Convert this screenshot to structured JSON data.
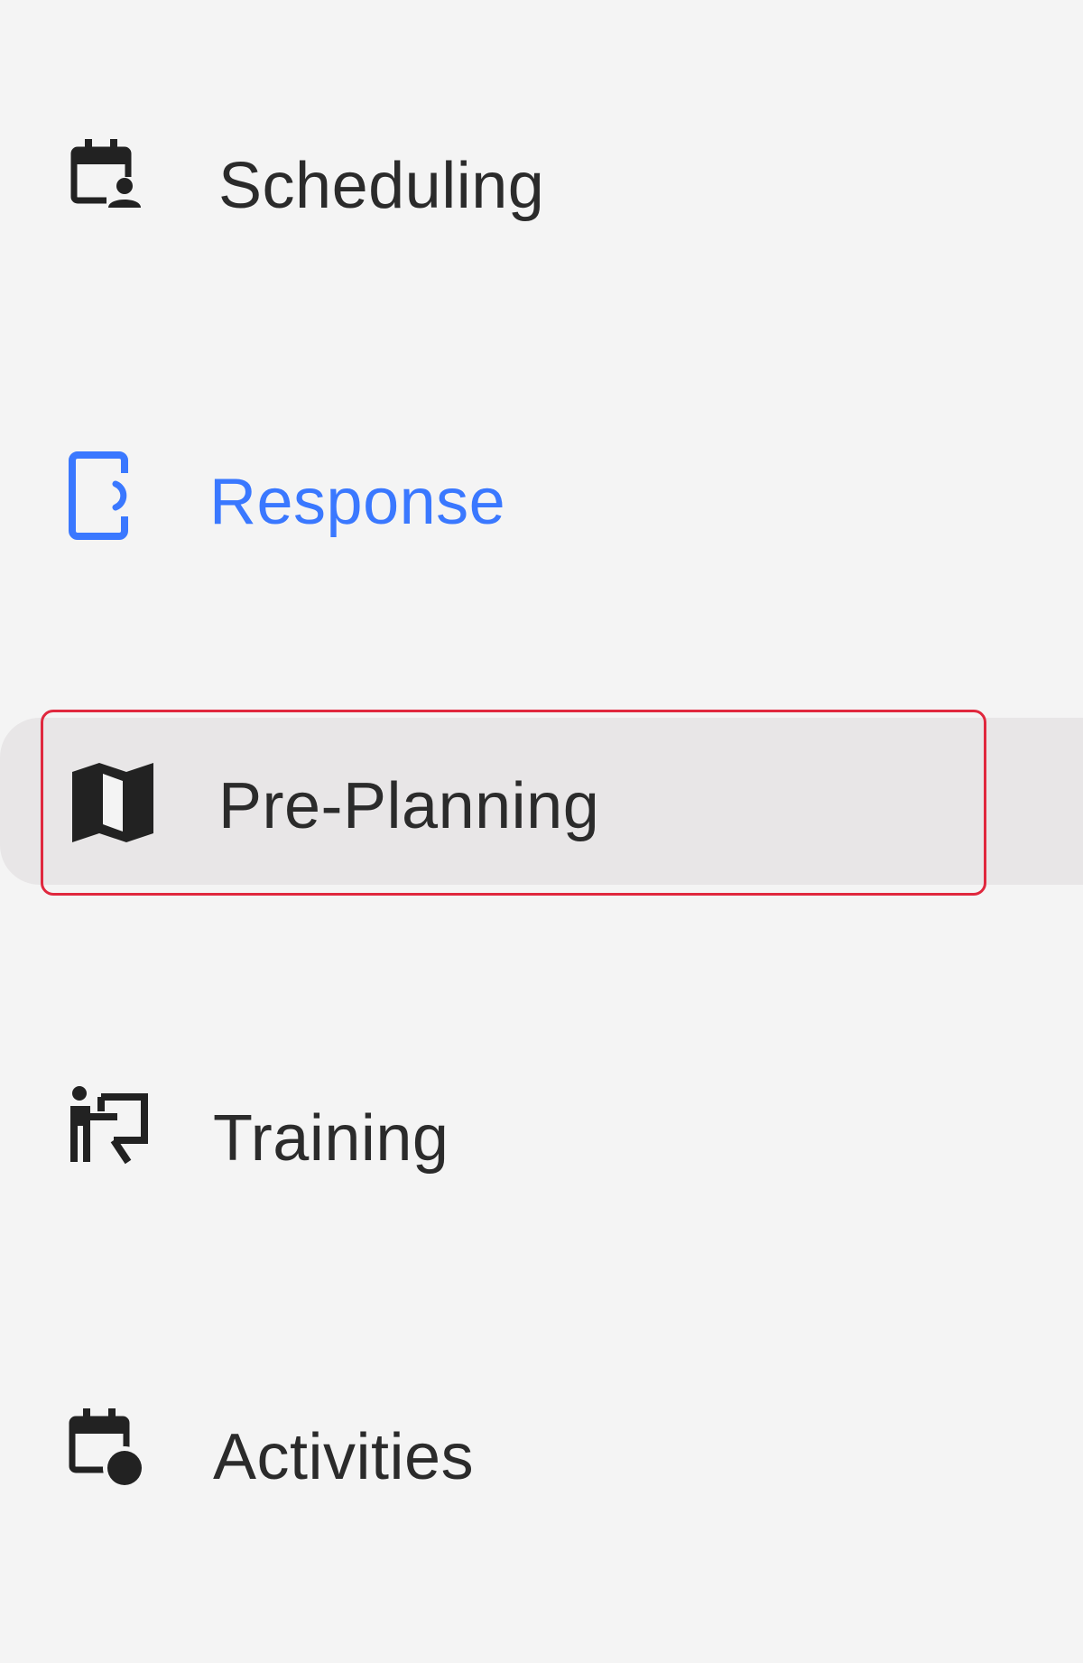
{
  "sidebar": {
    "items": [
      {
        "id": "scheduling",
        "label": "Scheduling",
        "icon": "calendar-person-icon",
        "active": false
      },
      {
        "id": "response",
        "label": "Response",
        "icon": "mobile-signal-icon",
        "active": true
      },
      {
        "id": "pre-planning",
        "label": "Pre-Planning",
        "icon": "map-icon",
        "active": false,
        "hovered": true
      },
      {
        "id": "training",
        "label": "Training",
        "icon": "presentation-person-icon",
        "active": false
      },
      {
        "id": "activities",
        "label": "Activities",
        "icon": "calendar-event-icon",
        "active": false
      }
    ],
    "colors": {
      "background": "#f4f4f4",
      "text": "#2b2b2b",
      "active": "#3a78ff",
      "hover_background": "#e8e6e7",
      "focus_outline": "#e0283e"
    }
  }
}
